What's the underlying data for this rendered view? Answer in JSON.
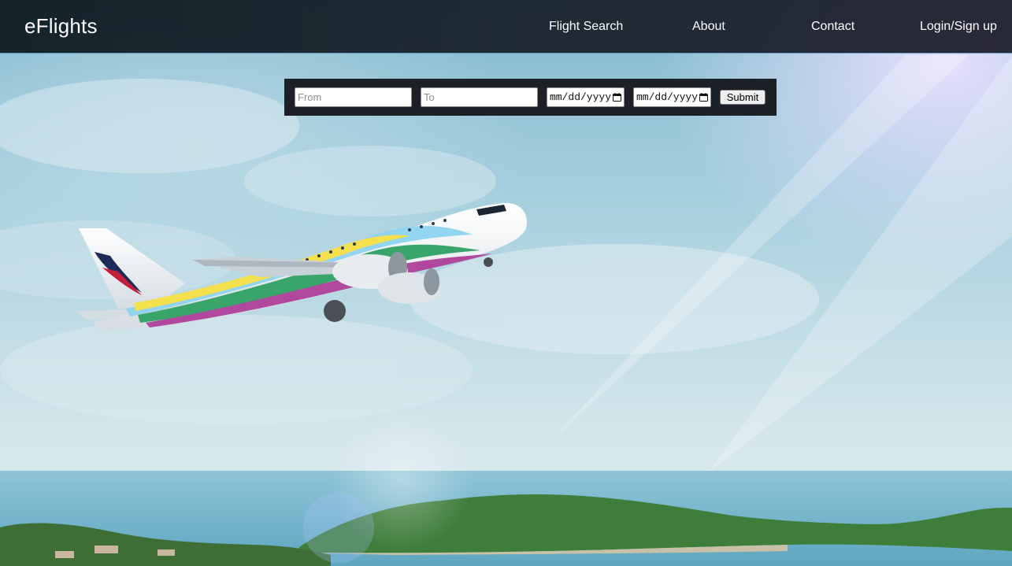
{
  "navbar": {
    "brand": "eFlights",
    "links": [
      {
        "label": "Flight Search"
      },
      {
        "label": "About"
      },
      {
        "label": "Contact"
      },
      {
        "label": "Login/Sign up"
      }
    ]
  },
  "search": {
    "from_placeholder": "From",
    "to_placeholder": "To",
    "depart_date_placeholder": "mm/dd/yyyy",
    "return_date_placeholder": "mm/dd/yyyy",
    "submit_label": "Submit"
  },
  "icons": {
    "calendar": "calendar-icon"
  },
  "colors": {
    "navbar_bg": "#141c24",
    "navbar_border": "#78c8f0",
    "search_bar_bg": "#1c2128",
    "text_light": "#ffffff"
  }
}
